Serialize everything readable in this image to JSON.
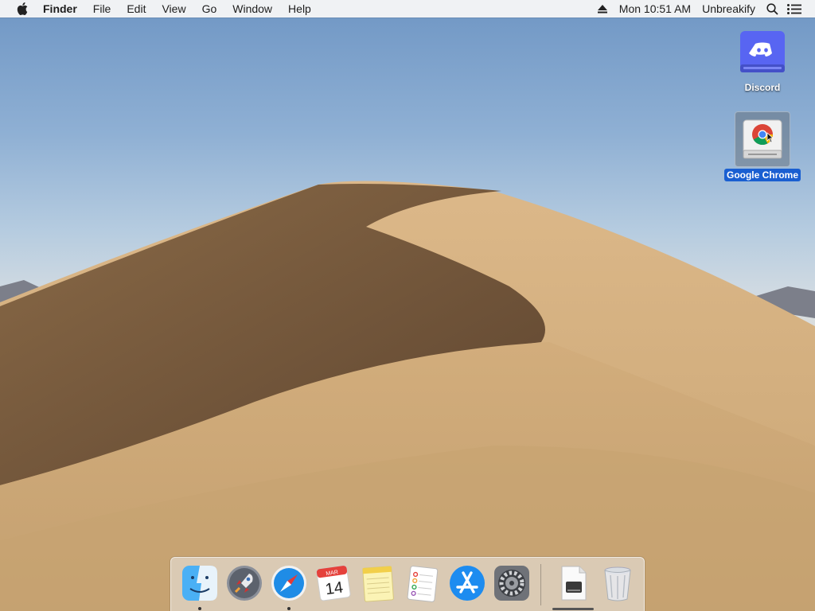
{
  "menubar": {
    "app_name": "Finder",
    "menus": [
      "File",
      "Edit",
      "View",
      "Go",
      "Window",
      "Help"
    ],
    "clock": "Mon 10:51 AM",
    "status_app": "Unbreakify"
  },
  "desktop": {
    "icons": [
      {
        "label": "Discord",
        "icon": "discord-disk-icon",
        "selected": false
      },
      {
        "label": "Google Chrome",
        "icon": "chrome-disk-icon",
        "selected": true
      }
    ]
  },
  "dock": {
    "apps": [
      {
        "name": "finder-icon",
        "running": true
      },
      {
        "name": "launchpad-icon",
        "running": false
      },
      {
        "name": "safari-icon",
        "running": true
      },
      {
        "name": "calendar-icon",
        "running": false,
        "month": "MAR",
        "day": "14"
      },
      {
        "name": "notes-icon",
        "running": false
      },
      {
        "name": "reminders-icon",
        "running": false
      },
      {
        "name": "app-store-icon",
        "running": false
      },
      {
        "name": "system-preferences-icon",
        "running": false
      }
    ],
    "others": [
      {
        "name": "disk-image-icon"
      },
      {
        "name": "trash-icon"
      }
    ]
  },
  "colors": {
    "selection": "#1a5fd1",
    "discord": "#5865f2"
  }
}
